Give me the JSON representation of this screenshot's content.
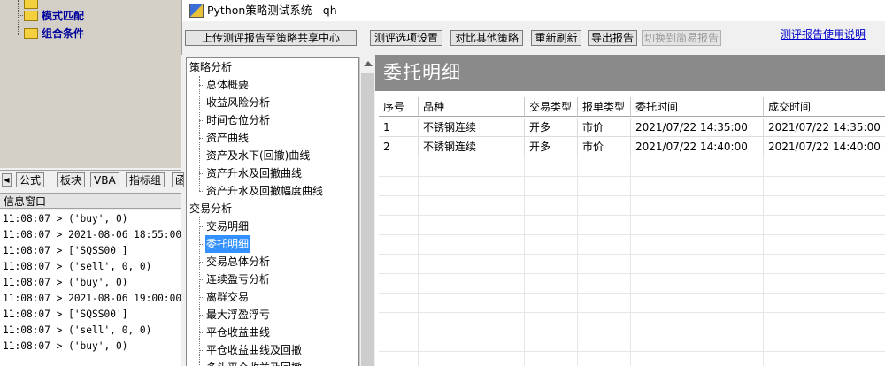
{
  "left_tree": {
    "items": [
      {
        "label": "模式匹配"
      },
      {
        "label": "组合条件"
      }
    ]
  },
  "tabs": [
    "公式",
    "板块",
    "VBA",
    "指标组",
    "函"
  ],
  "info_window": {
    "title": "信息窗口",
    "lines": [
      "11:08:07 > ('buy', 0)",
      "11:08:07 > 2021-08-06 18:55:00",
      "11:08:07 > ['SQSS00']",
      "11:08:07 > ('sell', 0, 0)",
      "11:08:07 > ('buy', 0)",
      "11:08:07 > 2021-08-06 19:00:00",
      "11:08:07 > ['SQSS00']",
      "11:08:07 > ('sell', 0, 0)",
      "11:08:07 > ('buy', 0)"
    ]
  },
  "window": {
    "title": "Python策略测试系统 - qh"
  },
  "toolbar": {
    "upload": "上传测评报告至策略共享中心",
    "settings": "测评选项设置",
    "compare": "对比其他策略",
    "refresh": "重新刷新",
    "export": "导出报告",
    "switch_simple": "切换到简易报告",
    "help_link": "测评报告使用说明"
  },
  "nav": {
    "sections": [
      {
        "label": "策略分析",
        "items": [
          "总体概要",
          "收益风险分析",
          "时间仓位分析",
          "资产曲线",
          "资产及水下(回撤)曲线",
          "资产升水及回撤曲线",
          "资产升水及回撤幅度曲线"
        ]
      },
      {
        "label": "交易分析",
        "items": [
          "交易明细",
          "委托明细",
          "交易总体分析",
          "连续盈亏分析",
          "离群交易",
          "最大浮盈浮亏",
          "平仓收益曲线",
          "平仓收益曲线及回撤",
          "多头平仓收益及回撤"
        ]
      }
    ],
    "selected": "委托明细"
  },
  "detail": {
    "title": "委托明细",
    "columns": [
      "序号",
      "品种",
      "交易类型",
      "报单类型",
      "委托时间",
      "成交时间"
    ],
    "rows": [
      [
        "1",
        "不锈钢连续",
        "开多",
        "市价",
        "2021/07/22 14:35:00",
        "2021/07/22 14:35:00"
      ],
      [
        "2",
        "不锈钢连续",
        "开多",
        "市价",
        "2021/07/22 14:40:00",
        "2021/07/22 14:40:00"
      ]
    ]
  },
  "colors": {
    "selection": "#3390ff",
    "header_band": "#8a8a8a",
    "link": "#0000cc"
  }
}
